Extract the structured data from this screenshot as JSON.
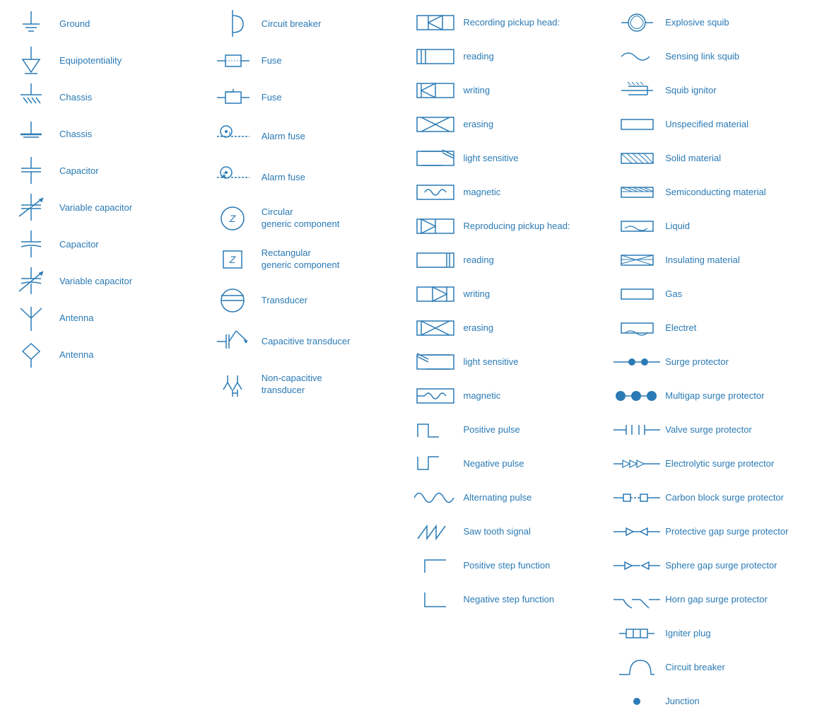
{
  "columns": [
    {
      "id": "col1",
      "items": [
        {
          "id": "ground",
          "label": "Ground"
        },
        {
          "id": "equipotentiality",
          "label": "Equipotentiality"
        },
        {
          "id": "chassis1",
          "label": "Chassis"
        },
        {
          "id": "chassis2",
          "label": "Chassis"
        },
        {
          "id": "capacitor1",
          "label": "Capacitor"
        },
        {
          "id": "variable-capacitor1",
          "label": "Variable capacitor"
        },
        {
          "id": "capacitor2",
          "label": "Capacitor"
        },
        {
          "id": "variable-capacitor2",
          "label": "Variable capacitor"
        },
        {
          "id": "antenna1",
          "label": "Antenna"
        },
        {
          "id": "antenna2",
          "label": "Antenna"
        }
      ]
    },
    {
      "id": "col2",
      "items": [
        {
          "id": "circuit-breaker",
          "label": "Circuit breaker"
        },
        {
          "id": "fuse1",
          "label": "Fuse"
        },
        {
          "id": "fuse2",
          "label": "Fuse"
        },
        {
          "id": "alarm-fuse1",
          "label": "Alarm fuse"
        },
        {
          "id": "alarm-fuse2",
          "label": "Alarm fuse"
        },
        {
          "id": "circular-generic",
          "label": "Circular\ngeneric component"
        },
        {
          "id": "rectangular-generic",
          "label": "Rectangular\ngeneric component"
        },
        {
          "id": "transducer",
          "label": "Transducer"
        },
        {
          "id": "capacitive-transducer",
          "label": "Capacitive transducer"
        },
        {
          "id": "non-capacitive-transducer",
          "label": "Non-capacitive\ntransducer"
        }
      ]
    },
    {
      "id": "col3",
      "items": [
        {
          "id": "recording-reading",
          "label": "Recording pickup head:"
        },
        {
          "id": "rec-reading",
          "label": "reading"
        },
        {
          "id": "rec-writing",
          "label": "writing"
        },
        {
          "id": "rec-erasing",
          "label": "erasing"
        },
        {
          "id": "rec-light-sensitive",
          "label": "light sensitive"
        },
        {
          "id": "rec-magnetic",
          "label": "magnetic"
        },
        {
          "id": "reproducing-head",
          "label": "Reproducing pickup head:"
        },
        {
          "id": "rep-reading",
          "label": "reading"
        },
        {
          "id": "rep-writing",
          "label": "writing"
        },
        {
          "id": "rep-erasing",
          "label": "erasing"
        },
        {
          "id": "rep-light-sensitive",
          "label": "light sensitive"
        },
        {
          "id": "rep-magnetic",
          "label": "magnetic"
        },
        {
          "id": "positive-pulse",
          "label": "Positive pulse"
        },
        {
          "id": "negative-pulse",
          "label": "Negative pulse"
        },
        {
          "id": "alternating-pulse",
          "label": "Alternating pulse"
        },
        {
          "id": "saw-tooth",
          "label": "Saw tooth signal"
        },
        {
          "id": "positive-step",
          "label": "Positive step function"
        },
        {
          "id": "negative-step",
          "label": "Negative step function"
        }
      ]
    },
    {
      "id": "col4",
      "items": [
        {
          "id": "explosive-squib",
          "label": "Explosive squib"
        },
        {
          "id": "sensing-link-squib",
          "label": "Sensing link squib"
        },
        {
          "id": "squib-ignitor",
          "label": "Squib ignitor"
        },
        {
          "id": "unspecified-material",
          "label": "Unspecified material"
        },
        {
          "id": "solid-material",
          "label": "Solid material"
        },
        {
          "id": "semiconducting-material",
          "label": "Semiconducting material"
        },
        {
          "id": "liquid",
          "label": "Liquid"
        },
        {
          "id": "insulating-material",
          "label": "Insulating material"
        },
        {
          "id": "gas",
          "label": "Gas"
        },
        {
          "id": "electret",
          "label": "Electret"
        },
        {
          "id": "surge-protector",
          "label": "Surge protector"
        },
        {
          "id": "multigap-surge",
          "label": "Multigap surge protector"
        },
        {
          "id": "valve-surge",
          "label": "Valve surge protector"
        },
        {
          "id": "electrolytic-surge",
          "label": "Electrolytic surge protector"
        },
        {
          "id": "carbon-block-surge",
          "label": "Carbon block surge protector"
        },
        {
          "id": "protective-gap-surge",
          "label": "Protective gap surge protector"
        },
        {
          "id": "sphere-gap-surge",
          "label": "Sphere gap surge protector"
        },
        {
          "id": "horn-gap-surge",
          "label": "Horn gap surge protector"
        },
        {
          "id": "igniter-plug",
          "label": "Igniter plug"
        },
        {
          "id": "circuit-breaker2",
          "label": "Circuit breaker"
        },
        {
          "id": "junction",
          "label": "Junction"
        }
      ]
    }
  ]
}
